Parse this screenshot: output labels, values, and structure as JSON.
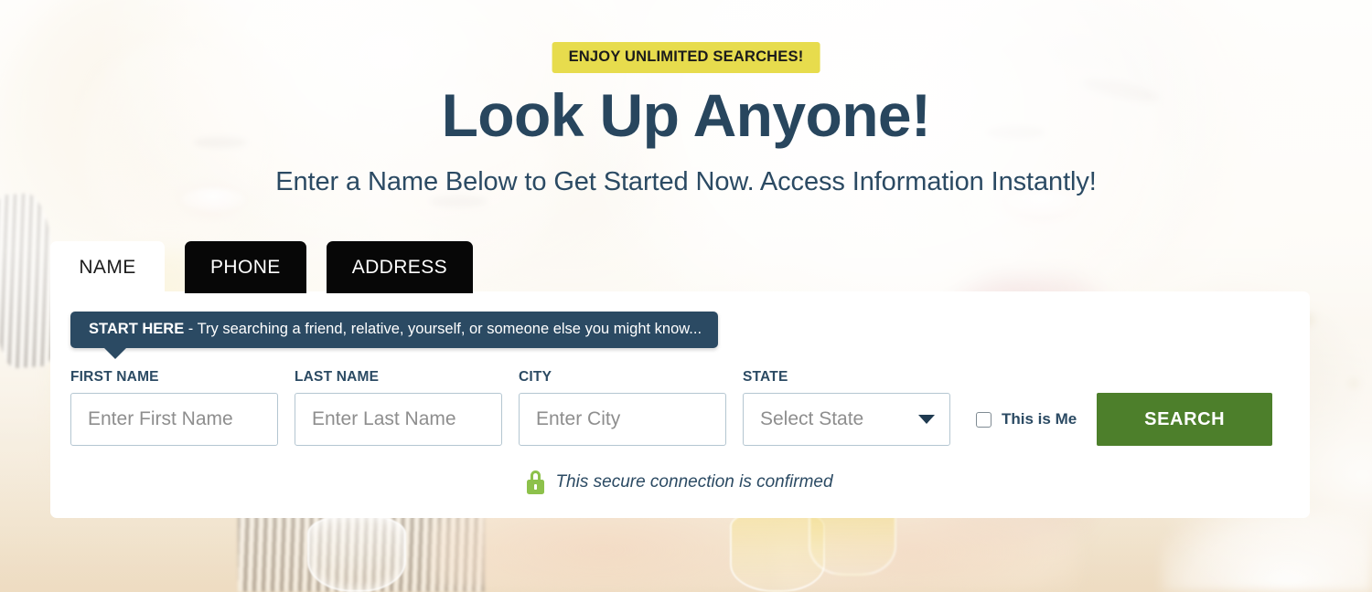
{
  "banner": {
    "text": "ENJOY UNLIMITED SEARCHES!",
    "bg_color": "#e7dc4d"
  },
  "hero": {
    "headline": "Look Up Anyone!",
    "subheadline": "Enter a Name Below to Get Started Now. Access Information Instantly!",
    "headline_color": "#28465e"
  },
  "tabs": [
    {
      "label": "NAME",
      "state": "active"
    },
    {
      "label": "PHONE",
      "state": "inactive"
    },
    {
      "label": "ADDRESS",
      "state": "inactive"
    }
  ],
  "tooltip": {
    "strong": "START HERE",
    "rest": " - Try searching a friend, relative, yourself, or someone else you might know...",
    "bg_color": "#2b4a63"
  },
  "form": {
    "fields": [
      {
        "label": "FIRST NAME",
        "placeholder": "Enter First Name",
        "value": ""
      },
      {
        "label": "LAST NAME",
        "placeholder": "Enter Last Name",
        "value": ""
      },
      {
        "label": "CITY",
        "placeholder": "Enter City",
        "value": ""
      }
    ],
    "state": {
      "label": "STATE",
      "selected": "Select State",
      "icon": "chevron-down-icon"
    },
    "checkbox": {
      "label": "This is Me",
      "checked": false
    },
    "submit": {
      "label": "SEARCH",
      "color": "#4d7f2b"
    }
  },
  "secure": {
    "icon": "lock-icon",
    "icon_color": "#8dc14b",
    "text": "This secure connection is confirmed"
  }
}
